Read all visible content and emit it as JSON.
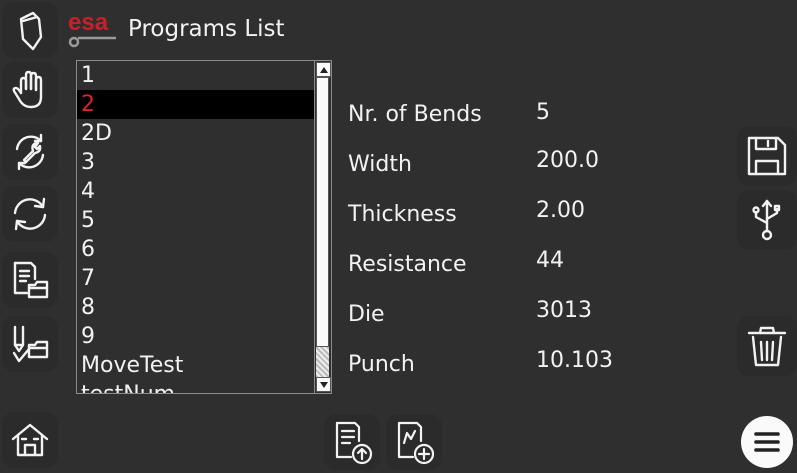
{
  "header": {
    "logo_text": "esa",
    "title": "Programs List"
  },
  "programs": {
    "items": [
      "1",
      "2",
      "2D",
      "3",
      "4",
      "5",
      "6",
      "7",
      "8",
      "9",
      "MoveTest",
      "testNum"
    ],
    "selected_index": 1
  },
  "details": [
    {
      "label": "Nr. of Bends",
      "value": "5"
    },
    {
      "label": "Width",
      "value": "200.0"
    },
    {
      "label": "Thickness",
      "value": "2.00"
    },
    {
      "label": "Resistance",
      "value": "44"
    },
    {
      "label": "Die",
      "value": "3013"
    },
    {
      "label": "Punch",
      "value": "10.103"
    }
  ],
  "icons": {
    "left": [
      "pen-icon",
      "hand-icon",
      "tool-cycle-icon",
      "refresh-icon",
      "program-folder-icon",
      "bend-folder-icon",
      "home-icon"
    ],
    "right": [
      "save-icon",
      "usb-icon",
      "trash-icon",
      "menu-icon"
    ],
    "bottom": [
      "program-upload-icon",
      "new-program-icon"
    ]
  },
  "colors": {
    "background": "#2f2f2f",
    "selected_text": "#e0202a",
    "selected_bg": "#000000",
    "brand_red": "#c8202a"
  }
}
